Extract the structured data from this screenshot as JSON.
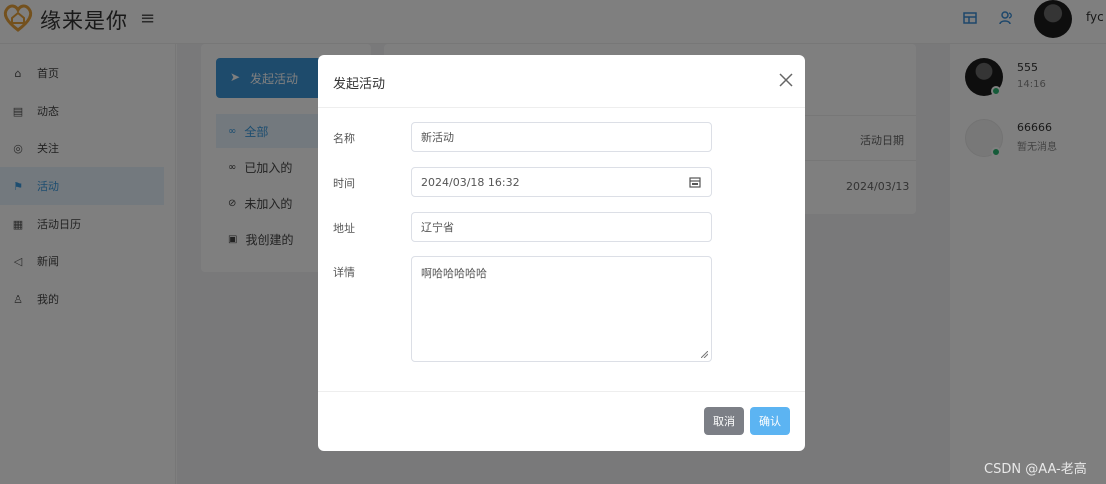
{
  "app": {
    "brand": "缘来是你",
    "username": "fyc"
  },
  "sidebar": {
    "items": [
      {
        "label": "首页",
        "icon": "home-icon",
        "glyph": "⌂"
      },
      {
        "label": "动态",
        "icon": "feed-icon",
        "glyph": "▤"
      },
      {
        "label": "关注",
        "icon": "check-circle-icon",
        "glyph": "◎"
      },
      {
        "label": "活动",
        "icon": "flag-icon",
        "glyph": "⚑",
        "active": true
      },
      {
        "label": "活动日历",
        "icon": "calendar-icon",
        "glyph": "▦"
      },
      {
        "label": "新闻",
        "icon": "speaker-icon",
        "glyph": "◁"
      },
      {
        "label": "我的",
        "icon": "user-icon",
        "glyph": "♙"
      }
    ]
  },
  "activity": {
    "launch_label": "发起活动",
    "filters": [
      {
        "label": "全部",
        "active": true
      },
      {
        "label": "已加入的"
      },
      {
        "label": "未加入的"
      },
      {
        "label": "我创建的"
      }
    ],
    "column_date": "活动日期",
    "row_date": "2024/03/13"
  },
  "chats": [
    {
      "name": "555",
      "sub": "14:16"
    },
    {
      "name": "66666",
      "sub": "暂无消息"
    }
  ],
  "dialog": {
    "title": "发起活动",
    "fields": {
      "name_label": "名称",
      "name_value": "新活动",
      "time_label": "时间",
      "time_value": "2024/03/18 16:32",
      "address_label": "地址",
      "address_value": "辽宁省",
      "details_label": "详情",
      "details_value": "啊哈哈哈哈哈"
    },
    "cancel_label": "取消",
    "confirm_label": "确认"
  },
  "watermark": "CSDN @AA-老高",
  "colors": {
    "primary": "#3d96d9",
    "accent_light": "#5cb4f2",
    "online": "#2bb673",
    "logo": "#e8a23b"
  }
}
